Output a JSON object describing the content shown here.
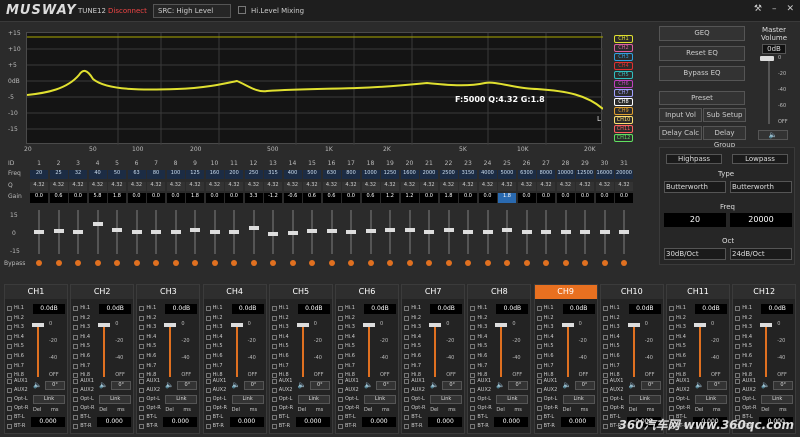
{
  "top": {
    "logo": "MUSWAY",
    "model": "TUNE12",
    "status": "Disconnect",
    "src": "SRC: High Level",
    "hl_mixing": "Hi.Level Mixing"
  },
  "graph": {
    "y_ticks": [
      "+15",
      "+10",
      "+5",
      "0dB",
      "-5",
      "-10",
      "-15"
    ],
    "x_ticks": [
      "20",
      "50",
      "100",
      "200",
      "500",
      "1K",
      "2K",
      "5K",
      "10K",
      "20K"
    ],
    "readout": "F:5000 Q:4.32 G:1.8",
    "end_label": "L"
  },
  "legend": [
    "CH1",
    "CH2",
    "CH3",
    "CH4",
    "CH5",
    "CH6",
    "CH7",
    "CH8",
    "CH9",
    "CH10",
    "CH11",
    "CH12"
  ],
  "legend_colors": [
    "#e0e030",
    "#e060a0",
    "#30a0e0",
    "#e03030",
    "#30c0c0",
    "#c040c0",
    "#a0a0ff",
    "#ffffff",
    "#e0a030",
    "#ffe070",
    "#ff6060",
    "#60e060"
  ],
  "right": {
    "geq": "GEQ",
    "reset_eq": "Reset EQ",
    "bypass_eq": "Bypass EQ",
    "preset": "Preset",
    "input_vol": "Input Vol",
    "sub_setup": "Sub Setup",
    "delay_calc": "Delay Calc",
    "delay_group": "Delay Group",
    "highpass": "Highpass",
    "lowpass": "Lowpass",
    "type": "Type",
    "hp_type": "Butterworth",
    "lp_type": "Butterworth",
    "freq": "Freq",
    "hp_freq": "20",
    "lp_freq": "20000",
    "oct": "Oct",
    "hp_oct": "30dB/Oct",
    "lp_oct": "24dB/Oct"
  },
  "master": {
    "title": "Master Volume",
    "value": "0dB",
    "ticks": [
      "0",
      "-20",
      "-40",
      "-60",
      "OFF"
    ]
  },
  "bands": {
    "ids": [
      "1",
      "2",
      "3",
      "4",
      "5",
      "6",
      "7",
      "8",
      "9",
      "10",
      "11",
      "12",
      "13",
      "14",
      "15",
      "16",
      "17",
      "18",
      "19",
      "20",
      "21",
      "22",
      "23",
      "24",
      "25",
      "26",
      "27",
      "28",
      "29",
      "30",
      "31"
    ],
    "freq": [
      "20",
      "25",
      "32",
      "40",
      "50",
      "63",
      "80",
      "100",
      "125",
      "160",
      "200",
      "250",
      "315",
      "400",
      "500",
      "630",
      "800",
      "1000",
      "1250",
      "1600",
      "2000",
      "2500",
      "3150",
      "4000",
      "5000",
      "6300",
      "8000",
      "10000",
      "12500",
      "16000",
      "20000"
    ],
    "q": [
      "4.32",
      "4.32",
      "4.32",
      "4.32",
      "4.32",
      "4.32",
      "4.32",
      "4.32",
      "4.32",
      "4.32",
      "4.32",
      "4.32",
      "4.32",
      "4.32",
      "4.32",
      "4.32",
      "4.32",
      "4.32",
      "4.32",
      "4.32",
      "4.32",
      "4.32",
      "4.32",
      "4.32",
      "4.32",
      "4.32",
      "4.32",
      "4.32",
      "4.32",
      "4.32",
      "4.32"
    ],
    "gain": [
      "0.0",
      "0.6",
      "0.0",
      "5.8",
      "1.8",
      "0.0",
      "0.0",
      "0.0",
      "1.8",
      "0.0",
      "0.0",
      "3.3",
      "-1.2",
      "-0.6",
      "0.6",
      "0.6",
      "0.0",
      "0.6",
      "1.2",
      "1.2",
      "0.0",
      "1.8",
      "0.0",
      "0.0",
      "1.8",
      "0.0",
      "0.0",
      "0.0",
      "0.0",
      "0.0",
      "0.0"
    ],
    "labels": [
      "ID",
      "Freq",
      "Q",
      "Gain",
      "15",
      "0",
      "-15",
      "Bypass"
    ]
  },
  "channels": [
    "CH1",
    "CH2",
    "CH3",
    "CH4",
    "CH5",
    "CH6",
    "CH7",
    "CH8",
    "CH9",
    "CH10",
    "CH11",
    "CH12"
  ],
  "ch_common": {
    "db": "0.0dB",
    "inputs": [
      "Hi.1",
      "Hi.2",
      "Hi.3",
      "Hi.4",
      "Hi.5",
      "Hi.6",
      "Hi.7",
      "Hi.8",
      "AUX1",
      "AUX2",
      "Opt-L",
      "Opt-R",
      "BT-L",
      "BT-R"
    ],
    "scale": [
      "0",
      "-20",
      "-40",
      "OFF"
    ],
    "phase": "0°",
    "link": "Link",
    "del": "Del",
    "ms": "ms",
    "delay": "0.000"
  },
  "watermark": "360汽车网 www.360qc.com"
}
